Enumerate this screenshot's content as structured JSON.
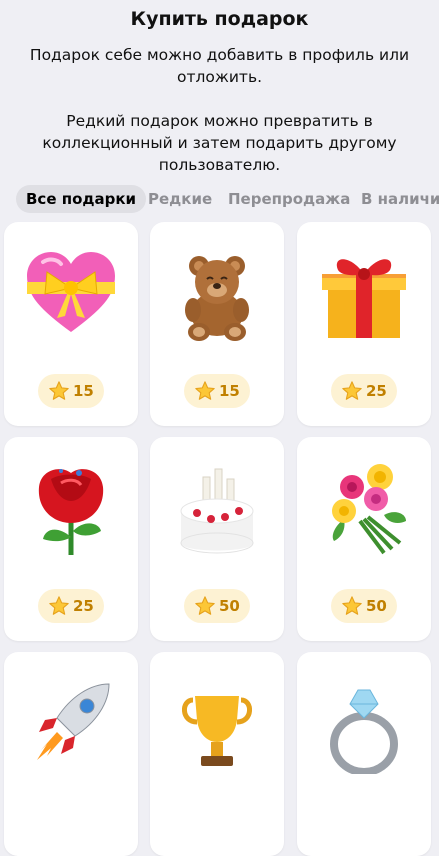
{
  "header": {
    "title": "Купить подарок",
    "description_1": "Подарок себе можно добавить в профиль или отложить.",
    "description_2": "Редкий подарок можно превратить в коллекционный и затем подарить другому пользователю."
  },
  "tabs": [
    {
      "label": "Все подарки",
      "active": true
    },
    {
      "label": "Редкие",
      "active": false
    },
    {
      "label": "Перепродажа",
      "active": false
    },
    {
      "label": "В наличии",
      "active": false
    }
  ],
  "gifts": [
    {
      "icon": "heart-gift-icon",
      "price": "15"
    },
    {
      "icon": "teddy-bear-icon",
      "price": "15"
    },
    {
      "icon": "gift-box-icon",
      "price": "25"
    },
    {
      "icon": "rose-icon",
      "price": "25"
    },
    {
      "icon": "birthday-cake-icon",
      "price": "50"
    },
    {
      "icon": "bouquet-icon",
      "price": "50"
    },
    {
      "icon": "rocket-icon",
      "price": ""
    },
    {
      "icon": "trophy-icon",
      "price": ""
    },
    {
      "icon": "diamond-ring-icon",
      "price": ""
    }
  ],
  "colors": {
    "background": "#efeff4",
    "card": "#ffffff",
    "price_pill": "#fdf2d3",
    "price_text": "#c08000",
    "active_tab": "#dfdfe4",
    "inactive_tab_text": "#8e8e93"
  }
}
